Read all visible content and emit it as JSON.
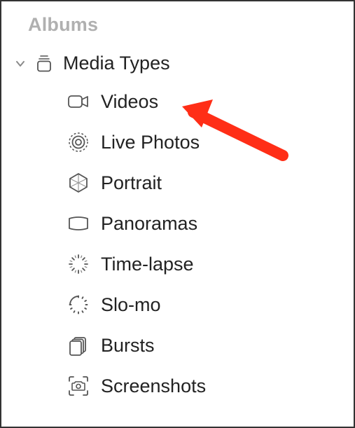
{
  "section": {
    "title": "Albums"
  },
  "group": {
    "label": "Media Types",
    "expanded": true
  },
  "items": [
    {
      "label": "Videos",
      "icon": "video-icon"
    },
    {
      "label": "Live Photos",
      "icon": "live-photos-icon"
    },
    {
      "label": "Portrait",
      "icon": "portrait-icon"
    },
    {
      "label": "Panoramas",
      "icon": "panoramas-icon"
    },
    {
      "label": "Time-lapse",
      "icon": "time-lapse-icon"
    },
    {
      "label": "Slo-mo",
      "icon": "slo-mo-icon"
    },
    {
      "label": "Bursts",
      "icon": "bursts-icon"
    },
    {
      "label": "Screenshots",
      "icon": "screenshots-icon"
    }
  ],
  "annotation": {
    "color": "#ff2e17",
    "target": "Videos"
  }
}
